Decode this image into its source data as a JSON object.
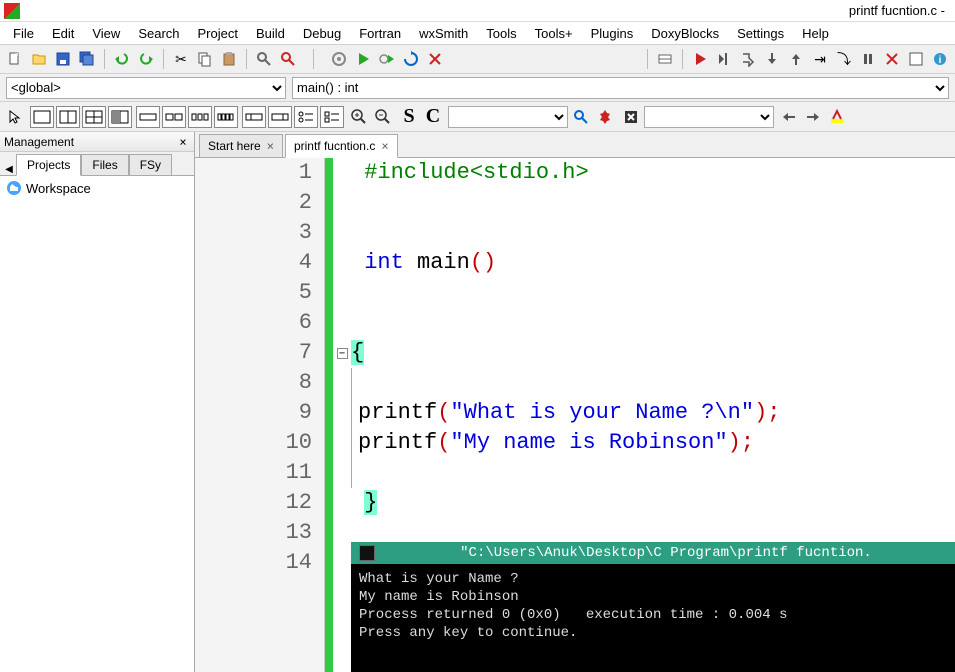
{
  "title": "printf fucntion.c -",
  "menu": [
    "File",
    "Edit",
    "View",
    "Search",
    "Project",
    "Build",
    "Debug",
    "Fortran",
    "wxSmith",
    "Tools",
    "Tools+",
    "Plugins",
    "DoxyBlocks",
    "Settings",
    "Help"
  ],
  "scope": {
    "global": "<global>",
    "func": "main() : int"
  },
  "management": {
    "title": "Management",
    "tabs": [
      "Projects",
      "Files",
      "FSy"
    ],
    "workspace": "Workspace"
  },
  "editor_tabs": [
    {
      "label": "Start here",
      "active": false
    },
    {
      "label": "printf fucntion.c",
      "active": true
    }
  ],
  "code_lines": 14,
  "code": {
    "include": "#include<stdio.h>",
    "intkw": "int",
    "mainid": " main",
    "paren_open": "(",
    "paren_close": ")",
    "brace_open": "{",
    "printf1_fn": "printf",
    "printf1_po": "(",
    "printf1_str": "\"What is your Name ?\\n\"",
    "printf1_pc": ")",
    "semi": ";",
    "printf2_fn": "printf",
    "printf2_str": "\"My name is Robinson\"",
    "brace_close": "}"
  },
  "console": {
    "path": "\"C:\\Users\\Anuk\\Desktop\\C Program\\printf fucntion.",
    "out1": "What is your Name ?",
    "out2": "My name is Robinson",
    "out3": "Process returned 0 (0x0)   execution time : 0.004 s",
    "out4": "Press any key to continue."
  }
}
